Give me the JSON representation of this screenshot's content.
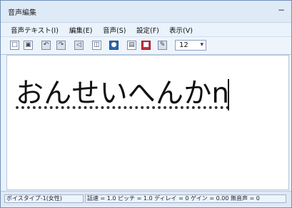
{
  "window": {
    "title": "音声編集",
    "minimize_glyph": "−"
  },
  "menu": {
    "items": [
      {
        "label": "音声テキスト(I)"
      },
      {
        "label": "編集(E)"
      },
      {
        "label": "音声(S)"
      },
      {
        "label": "設定(F)"
      },
      {
        "label": "表示(V)"
      }
    ]
  },
  "toolbar": {
    "icons": [
      {
        "name": "new-document-icon",
        "glyph": "□"
      },
      {
        "name": "save-icon",
        "glyph": "▣"
      },
      {
        "name": "undo-icon",
        "glyph": "↶"
      },
      {
        "name": "redo-icon",
        "glyph": "↷"
      },
      {
        "name": "speaker-icon",
        "glyph": "◁"
      },
      {
        "name": "voice-settings-icon",
        "glyph": "◫"
      },
      {
        "name": "globe-icon",
        "glyph": "●"
      },
      {
        "name": "image-icon",
        "glyph": "▤"
      },
      {
        "name": "book-icon",
        "glyph": "■"
      },
      {
        "name": "tool-icon",
        "glyph": "✎"
      }
    ],
    "font_size": "12",
    "font_size_arrow": "▾"
  },
  "editor": {
    "text": "おんせいへんかn"
  },
  "statusbar": {
    "voice_type": "ボイスタイプ-1(女性)",
    "params": "話速 = 1.0  ピッチ = 1.0  ディレイ = 0  ゲイン = 0.00  無音声 = 0"
  }
}
